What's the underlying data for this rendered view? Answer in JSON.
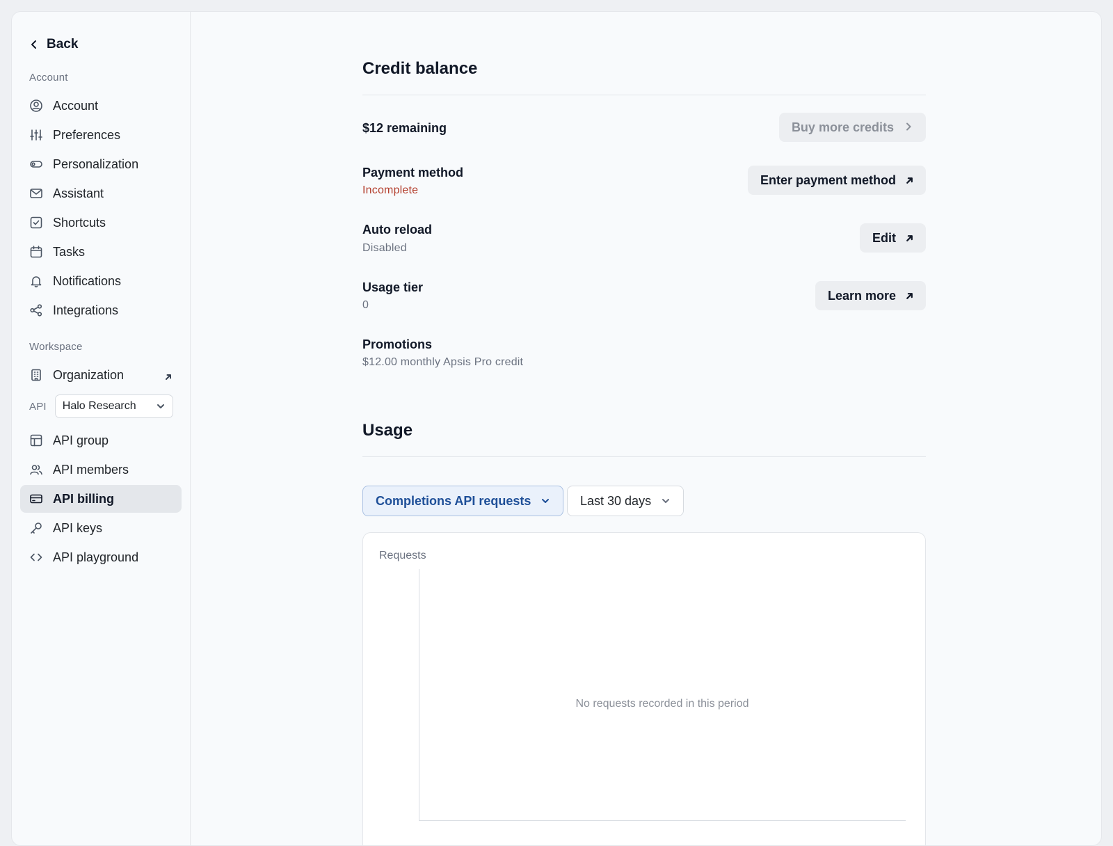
{
  "sidebar": {
    "back_label": "Back",
    "account_section": "Account",
    "account_items": [
      {
        "label": "Account",
        "icon": "user-circle-icon"
      },
      {
        "label": "Preferences",
        "icon": "sliders-icon"
      },
      {
        "label": "Personalization",
        "icon": "toggle-icon"
      },
      {
        "label": "Assistant",
        "icon": "mail-icon"
      },
      {
        "label": "Shortcuts",
        "icon": "checkbox-icon"
      },
      {
        "label": "Tasks",
        "icon": "calendar-icon"
      },
      {
        "label": "Notifications",
        "icon": "bell-icon"
      },
      {
        "label": "Integrations",
        "icon": "share-icon"
      }
    ],
    "workspace_section": "Workspace",
    "workspace_items": [
      {
        "label": "Organization",
        "icon": "building-icon",
        "external": true
      }
    ],
    "api_section": "API",
    "api_selector": {
      "value": "Halo Research"
    },
    "api_items": [
      {
        "label": "API group",
        "icon": "layout-icon"
      },
      {
        "label": "API members",
        "icon": "users-icon"
      },
      {
        "label": "API billing",
        "icon": "credit-card-icon",
        "active": true
      },
      {
        "label": "API keys",
        "icon": "key-icon"
      },
      {
        "label": "API playground",
        "icon": "code-icon"
      }
    ]
  },
  "credit": {
    "title": "Credit balance",
    "remaining": "$12 remaining",
    "buy_button": "Buy more credits",
    "payment_title": "Payment method",
    "payment_status": "Incomplete",
    "payment_button": "Enter payment method",
    "reload_title": "Auto reload",
    "reload_status": "Disabled",
    "reload_button": "Edit",
    "tier_title": "Usage tier",
    "tier_value": "0",
    "tier_button": "Learn more",
    "promo_title": "Promotions",
    "promo_value": "$12.00 monthly Apsis Pro credit"
  },
  "usage": {
    "title": "Usage",
    "metric_dropdown": "Completions API requests",
    "range_dropdown": "Last 30 days",
    "chart_label": "Requests",
    "empty_message": "No requests recorded in this period"
  },
  "colors": {
    "accent": "#1e4f98",
    "danger": "#b4402f",
    "active_bg": "#e4e7eb"
  }
}
